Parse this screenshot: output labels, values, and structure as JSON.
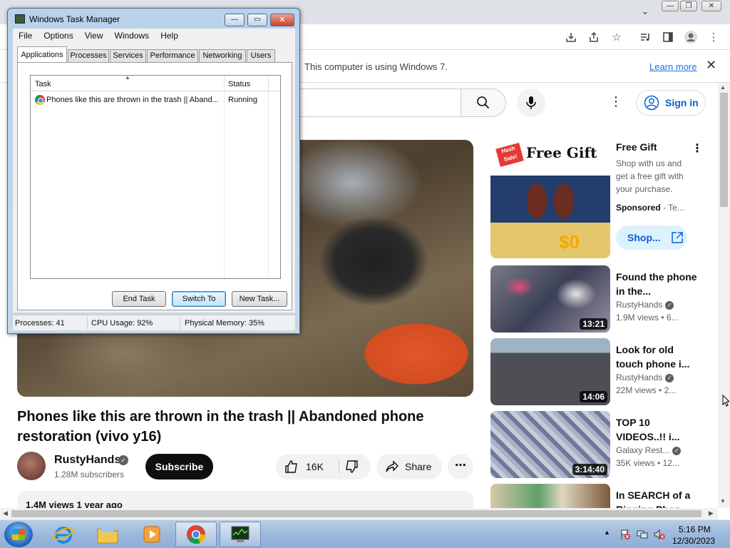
{
  "infobar": {
    "message": "This computer is using Windows 7.",
    "learn_more": "Learn more"
  },
  "youtube": {
    "sign_in": "Sign in",
    "video": {
      "title": "Phones like this are thrown in the trash || Abandoned phone restoration (vivo y16)",
      "channel": "RustyHands",
      "subscribers": "1.28M subscribers",
      "subscribe_label": "Subscribe",
      "likes": "16K",
      "share_label": "Share",
      "views_line": "1.4M views  1 year ago"
    },
    "ad": {
      "title": "Free Gift",
      "description": "Shop with us and get a free gift with your purchase.",
      "sponsored": "Sponsored",
      "advertiser": "Te...",
      "shop_label": "Shop...",
      "thumb_badge": "Hash Sale!",
      "thumb_headline": "Free Gift",
      "thumb_price": "$0"
    },
    "recommendations": [
      {
        "title": "Found the phone in the...",
        "channel": "RustyHands",
        "views": "1.9M views",
        "age": "6...",
        "duration": "13:21",
        "verified": true
      },
      {
        "title": "Look for old touch phone i...",
        "channel": "RustyHands",
        "views": "22M views",
        "age": "2...",
        "duration": "14:06",
        "verified": true
      },
      {
        "title": "TOP 10 VIDEOS..!! i...",
        "channel": "Galaxy Rest...",
        "views": "35K views",
        "age": "12...",
        "duration": "3:14:40",
        "verified": true
      },
      {
        "title": "In SEARCH of a Ringing Phon...",
        "channel": "",
        "views": "",
        "age": "",
        "duration": "",
        "verified": false
      }
    ]
  },
  "task_manager": {
    "title": "Windows Task Manager",
    "menu": [
      "File",
      "Options",
      "View",
      "Windows",
      "Help"
    ],
    "tabs": [
      "Applications",
      "Processes",
      "Services",
      "Performance",
      "Networking",
      "Users"
    ],
    "active_tab": "Applications",
    "columns": {
      "task": "Task",
      "status": "Status"
    },
    "rows": [
      {
        "task": "Phones like this are thrown in the trash || Aband...",
        "status": "Running"
      }
    ],
    "buttons": {
      "end_task": "End Task",
      "switch_to": "Switch To",
      "new_task": "New Task..."
    },
    "status_bar": {
      "processes": "Processes: 41",
      "cpu": "CPU Usage: 92%",
      "memory": "Physical Memory: 35%"
    }
  },
  "taskbar": {
    "time": "5:16 PM",
    "date": "12/30/2023"
  }
}
